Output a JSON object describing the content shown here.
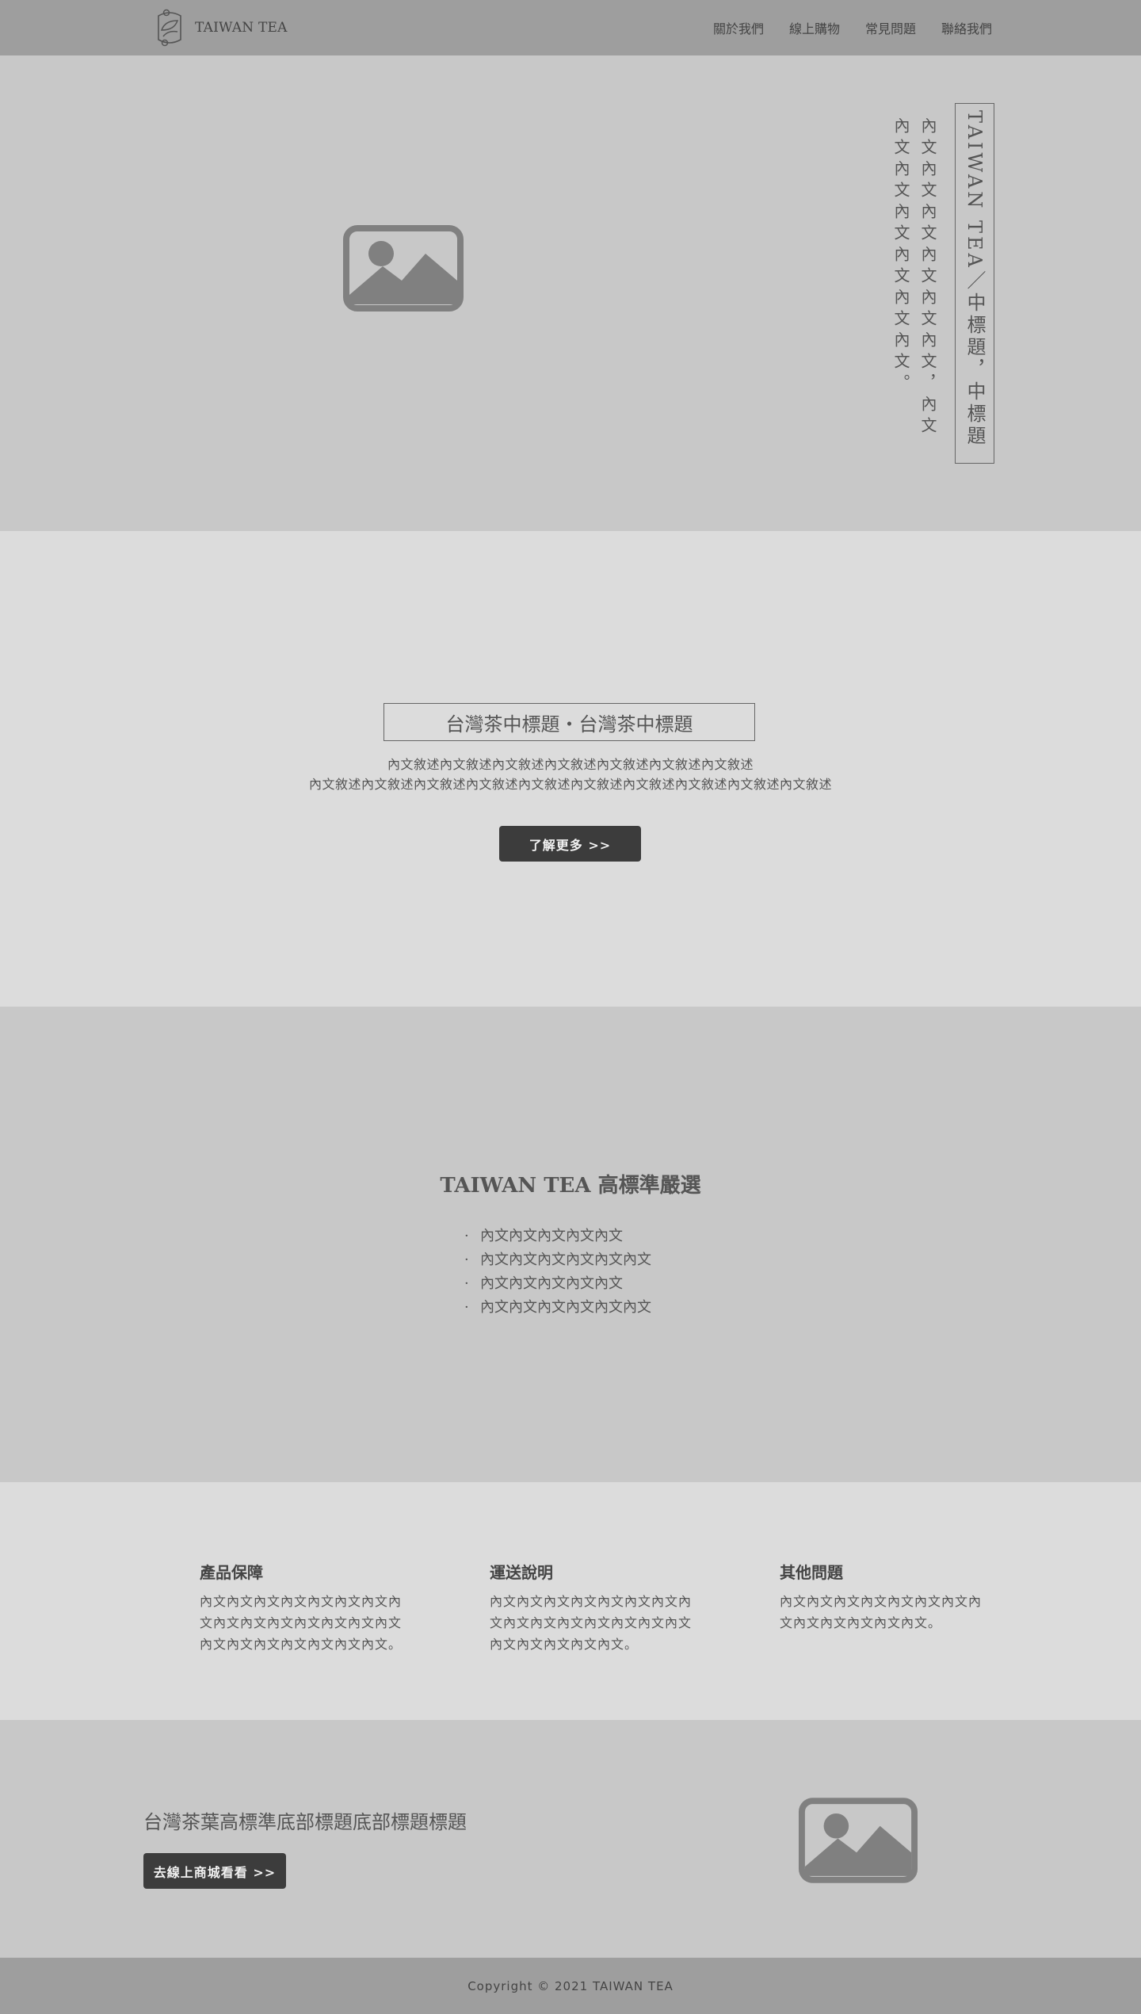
{
  "header": {
    "brand": "TAIWAN TEA",
    "logo_icon": "tea-leaf-logo",
    "nav": [
      {
        "label": "關於我們"
      },
      {
        "label": "線上購物"
      },
      {
        "label": "常見問題"
      },
      {
        "label": "聯絡我們"
      }
    ]
  },
  "hero": {
    "image_icon": "image-placeholder-icon",
    "title": "TAIWAN TEA／中標題，中標題",
    "body": "內文內文內文內文內文內文，內文內文內文內文內文內文內文。"
  },
  "intro": {
    "title": "台灣茶中標題・台灣茶中標題",
    "line1": "內文敘述內文敘述內文敘述內文敘述內文敘述內文敘述內文敘述",
    "line2": "內文敘述內文敘述內文敘述內文敘述內文敘述內文敘述內文敘述內文敘述內文敘述內文敘述",
    "button": "了解更多 >>"
  },
  "standards": {
    "title": "TAIWAN TEA 高標準嚴選",
    "items": [
      "內文內文內文內文內文",
      "內文內文內文內文內文內文",
      "內文內文內文內文內文",
      "內文內文內文內文內文內文"
    ]
  },
  "faq": [
    {
      "title": "產品保障",
      "body": "內文內文內文內文內文內文內文內文內文內文內文內文內文內文內文內文內文內文內文內文內文內文。"
    },
    {
      "title": "運送說明",
      "body": "內文內文內文內文內文內文內文內文內文內文內文內文內文內文內文內文內文內文內文內文。"
    },
    {
      "title": "其他問題",
      "body": "內文內文內文內文內文內文內文內文內文內文內文內文內文。"
    }
  ],
  "cta": {
    "title": "台灣茶葉高標準底部標題底部標題標題",
    "button": "去線上商城看看 >>",
    "image_icon": "image-placeholder-icon"
  },
  "footer": {
    "copyright": "Copyright © 2021 TAIWAN TEA"
  },
  "colors": {
    "header_bg": "#9e9e9e",
    "section_dark": "#c8c8c8",
    "section_light": "#dcdcdc",
    "button_bg": "#3c3c3c",
    "placeholder": "#808080"
  }
}
